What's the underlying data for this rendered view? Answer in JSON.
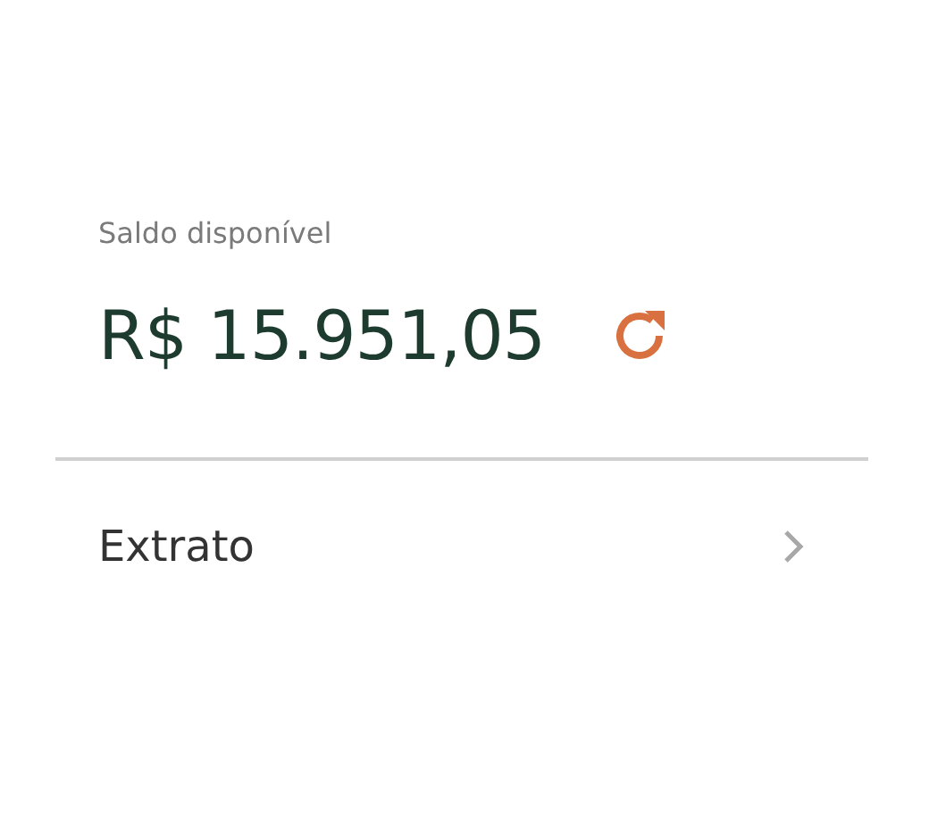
{
  "balance": {
    "label": "Saldo disponível",
    "amount": "R$ 15.951,05"
  },
  "menu_items": [
    {
      "label": "Extrato"
    }
  ]
}
